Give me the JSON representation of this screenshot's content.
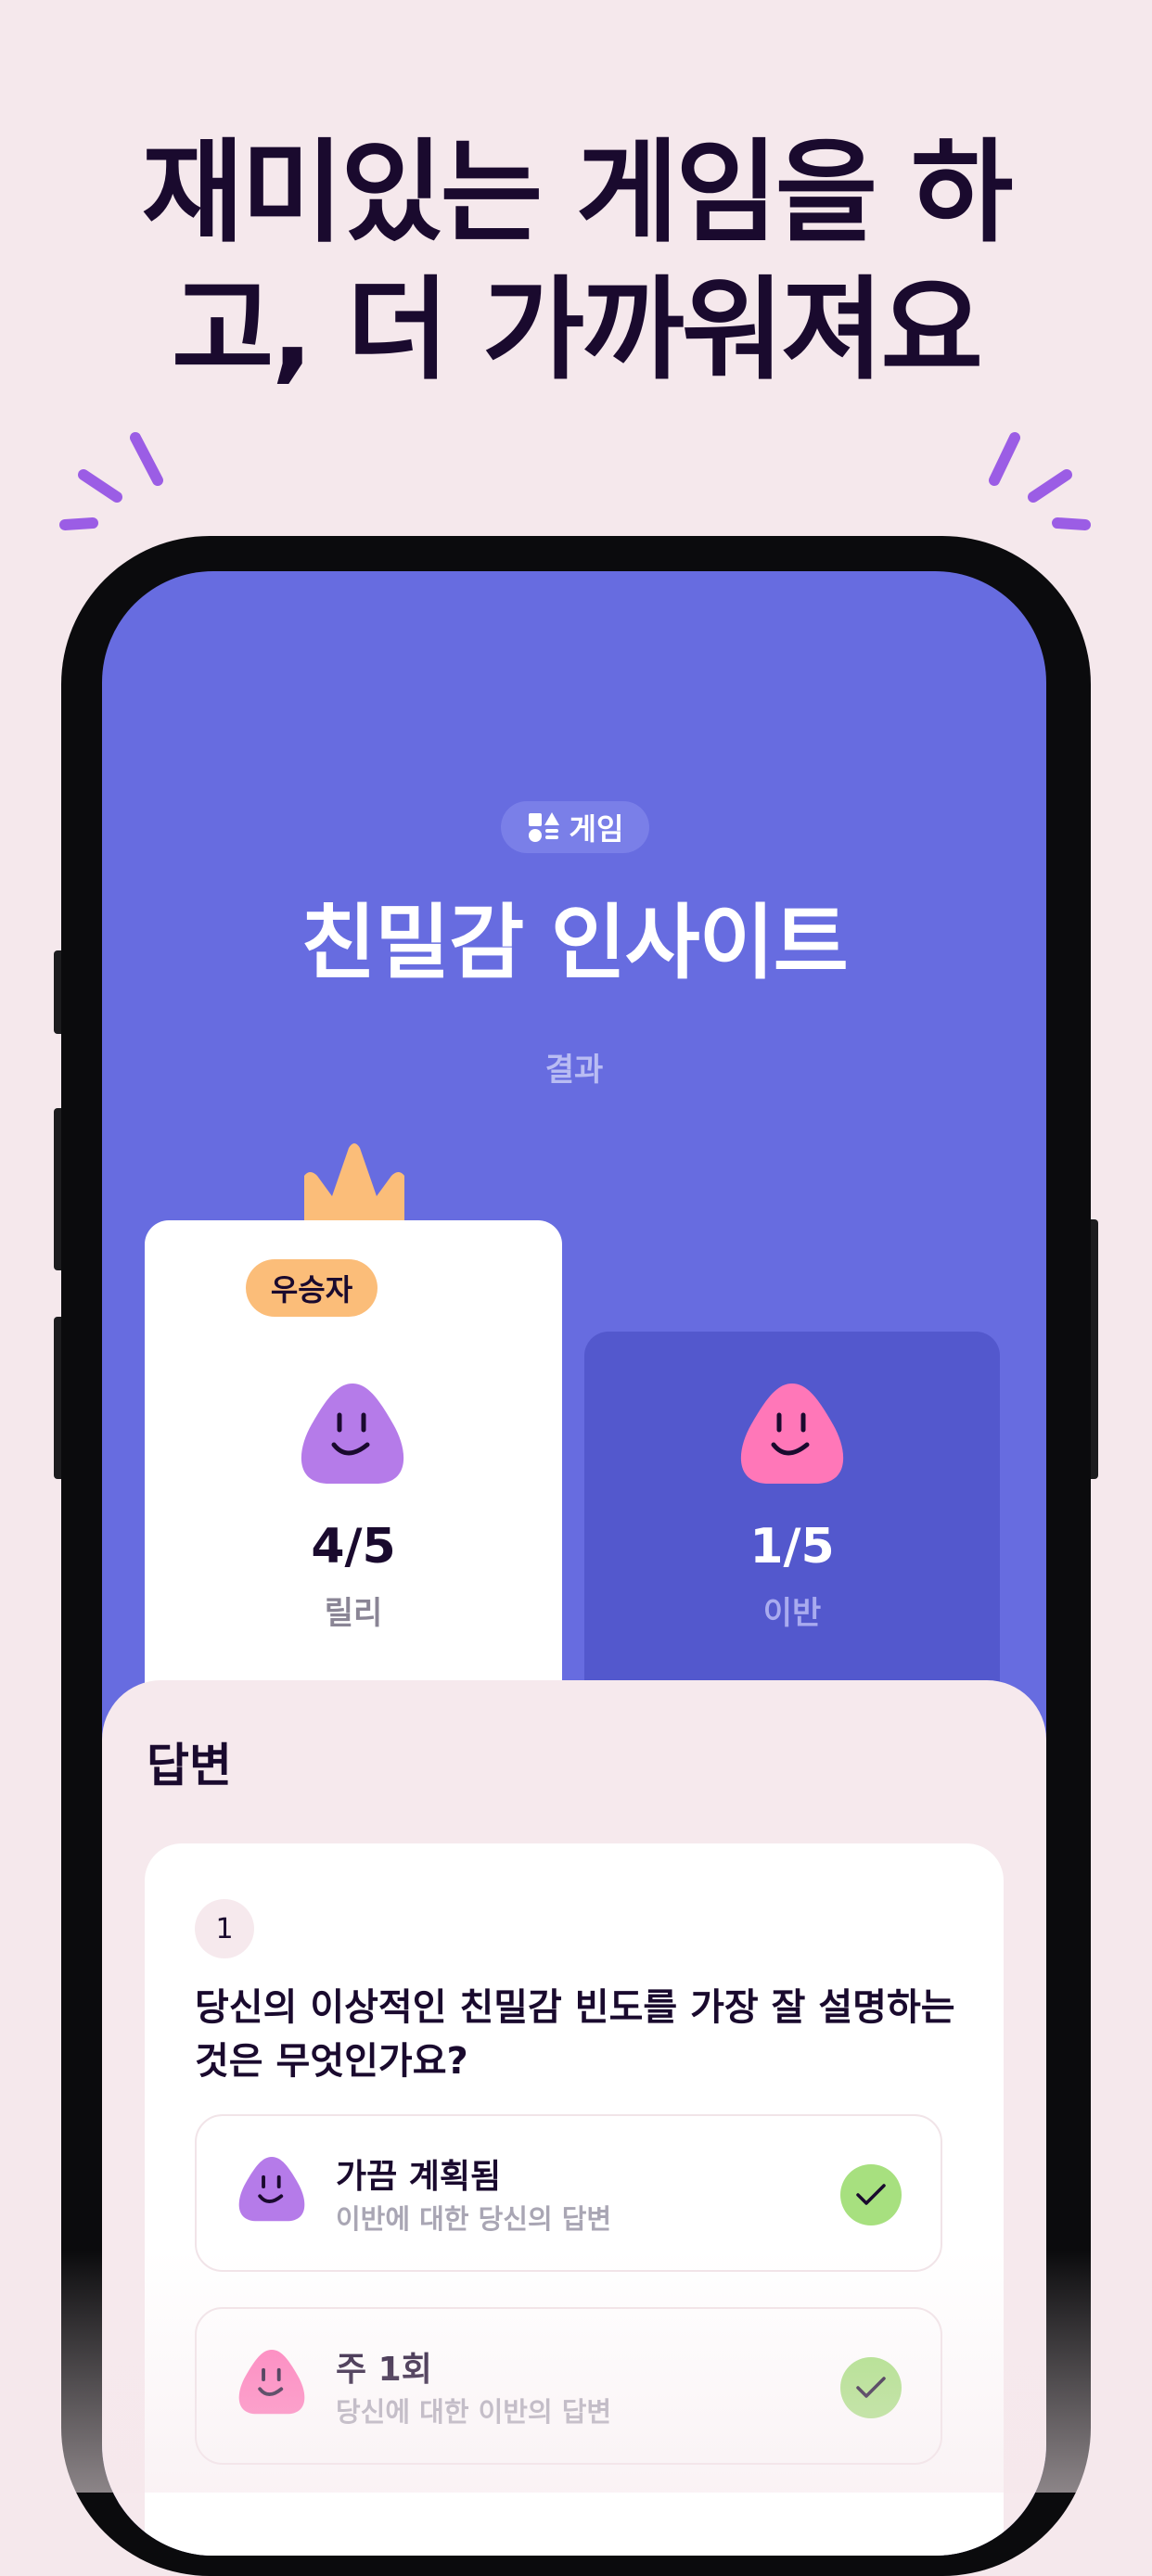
{
  "headline": {
    "line1": "재미있는 게임을 하",
    "line2": "고, 더 가까워져요"
  },
  "game_screen": {
    "category_pill": "게임",
    "title": "친밀감 인사이트",
    "subtitle": "결과"
  },
  "winner": {
    "badge": "우승자",
    "score": "4/5",
    "name": "릴리",
    "avatar_color": "#b57be9"
  },
  "opponent": {
    "score": "1/5",
    "name": "이반",
    "avatar_color": "#ff77b8"
  },
  "answers_section": {
    "title": "답변",
    "question_number": "1",
    "question": "당신의 이상적인 친밀감 빈도를 가장 잘 설명하는 것은 무엇인가요?",
    "answers": [
      {
        "title": "가끔 계획됨",
        "subtitle": "이반에 대한 당신의 답변",
        "icon": "check-icon"
      },
      {
        "title": "주 1회",
        "subtitle": "당신에 대한 이반의 답변",
        "icon": "check-icon"
      }
    ]
  },
  "colors": {
    "background": "#f5e8ec",
    "screen": "#676ce0",
    "accent_purple": "#9b5de5",
    "crown": "#fbbd79",
    "check": "#a7e07f"
  }
}
